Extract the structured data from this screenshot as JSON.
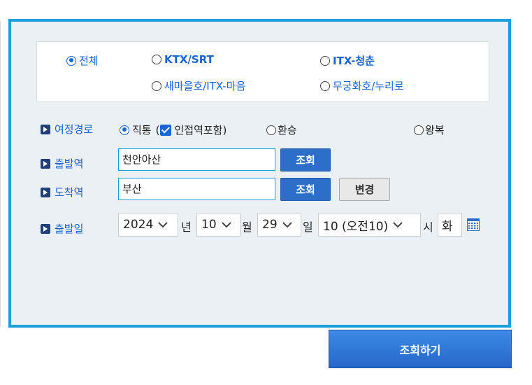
{
  "train_types": [
    {
      "label": "전체",
      "selected": true,
      "bold": false
    },
    {
      "label": "KTX/SRT",
      "selected": false,
      "bold": true
    },
    {
      "label": "ITX-청춘",
      "selected": false,
      "bold": false,
      "bold_prefix": "ITX",
      "suffix": "-청춘"
    },
    {
      "label": "새마을호/ITX-마음",
      "selected": false
    },
    {
      "label": "무궁화호/누리로",
      "selected": false
    }
  ],
  "route": {
    "label": "여정경로",
    "direct_label": "직통",
    "open_paren": "(",
    "adjacent_label": "인접역포함)",
    "adjacent_checked": true,
    "transfer_label": "환승",
    "roundtrip_label": "왕복",
    "selected": "direct"
  },
  "departure": {
    "label": "출발역",
    "value": "천안아산",
    "search_label": "조회"
  },
  "arrival": {
    "label": "도착역",
    "value": "부산",
    "search_label": "조회",
    "swap_label": "변경"
  },
  "date": {
    "label": "출발일",
    "year": "2024",
    "year_unit": "년",
    "month": "10",
    "month_unit": "월",
    "day": "29",
    "day_unit": "일",
    "hour": "10 (오전10)",
    "hour_unit": "시",
    "weekday": "화"
  },
  "submit_label": "조회하기",
  "colors": {
    "accent": "#1a9fdb",
    "link_blue": "#1a64d6",
    "button_blue": "#2d6fc8",
    "panel_bg": "#eaf0f3"
  }
}
